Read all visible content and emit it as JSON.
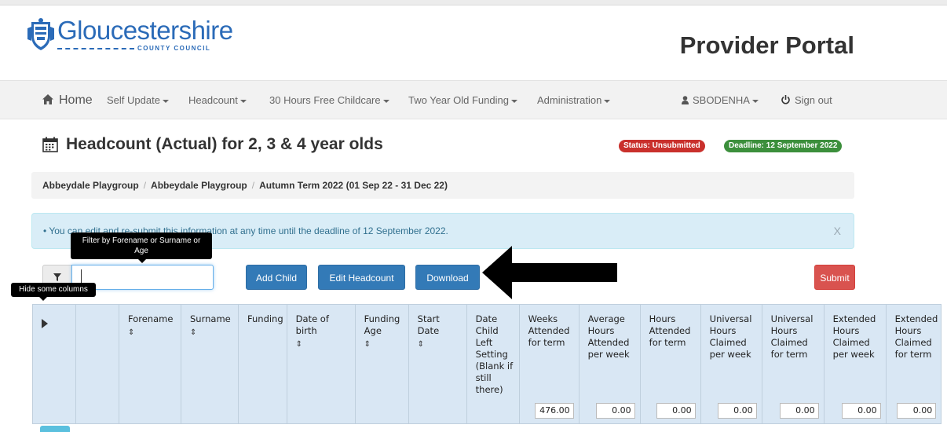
{
  "header": {
    "logo_text": "Gloucestershire",
    "logo_subtext": "COUNTY COUNCIL",
    "portal_title": "Provider Portal"
  },
  "nav": {
    "home": "Home",
    "items": [
      "Self Update",
      "Headcount",
      "30 Hours Free Childcare",
      "Two Year Old Funding",
      "Administration"
    ],
    "user": "SBODENHA",
    "signout": "Sign out"
  },
  "page": {
    "title": "Headcount (Actual) for 2, 3 & 4 year olds",
    "status_badge": "Status: Unsubmitted",
    "deadline_badge": "Deadline: 12 September 2022",
    "status_color": "#c9302c",
    "deadline_color": "#3c8f3c"
  },
  "breadcrumb": [
    "Abbeydale Playgroup",
    "Abbeydale Playgroup",
    "Autumn Term 2022 (01 Sep 22 - 31 Dec 22)"
  ],
  "alert": {
    "text": "• You can edit and re-submit this information at any time until the deadline of 12 September 2022.",
    "close": "X"
  },
  "tooltips": {
    "filter": "Filter by Forename or Surname or Age",
    "columns": "Hide some columns"
  },
  "toolbar": {
    "filter_value": "",
    "add_child": "Add Child",
    "edit_headcount": "Edit Headcount",
    "download": "Download",
    "submit": "Submit"
  },
  "table": {
    "columns": [
      {
        "label": "",
        "sortable": false,
        "total": ""
      },
      {
        "label": "",
        "sortable": false,
        "total": ""
      },
      {
        "label": "Forename",
        "sortable": true,
        "total": ""
      },
      {
        "label": "Surname",
        "sortable": true,
        "total": ""
      },
      {
        "label": "Funding",
        "sortable": false,
        "total": ""
      },
      {
        "label": "Date of birth",
        "sortable": true,
        "total": ""
      },
      {
        "label": "Funding Age",
        "sortable": true,
        "total": ""
      },
      {
        "label": "Start Date",
        "sortable": true,
        "total": ""
      },
      {
        "label": "Date Child Left Setting (Blank if still there)",
        "sortable": false,
        "total": ""
      },
      {
        "label": "Weeks Attended for term",
        "sortable": false,
        "total": "476.00"
      },
      {
        "label": "Average Hours Attended per week",
        "sortable": false,
        "total": "0.00"
      },
      {
        "label": "Hours Attended for term",
        "sortable": false,
        "total": "0.00"
      },
      {
        "label": "Universal Hours Claimed per week",
        "sortable": false,
        "total": "0.00"
      },
      {
        "label": "Universal Hours Claimed for term",
        "sortable": false,
        "total": "0.00"
      },
      {
        "label": "Extended Hours Claimed per week",
        "sortable": false,
        "total": "0.00"
      },
      {
        "label": "Extended Hours Claimed for term",
        "sortable": false,
        "total": "0.00"
      }
    ],
    "sort_glyph": "⇕"
  }
}
